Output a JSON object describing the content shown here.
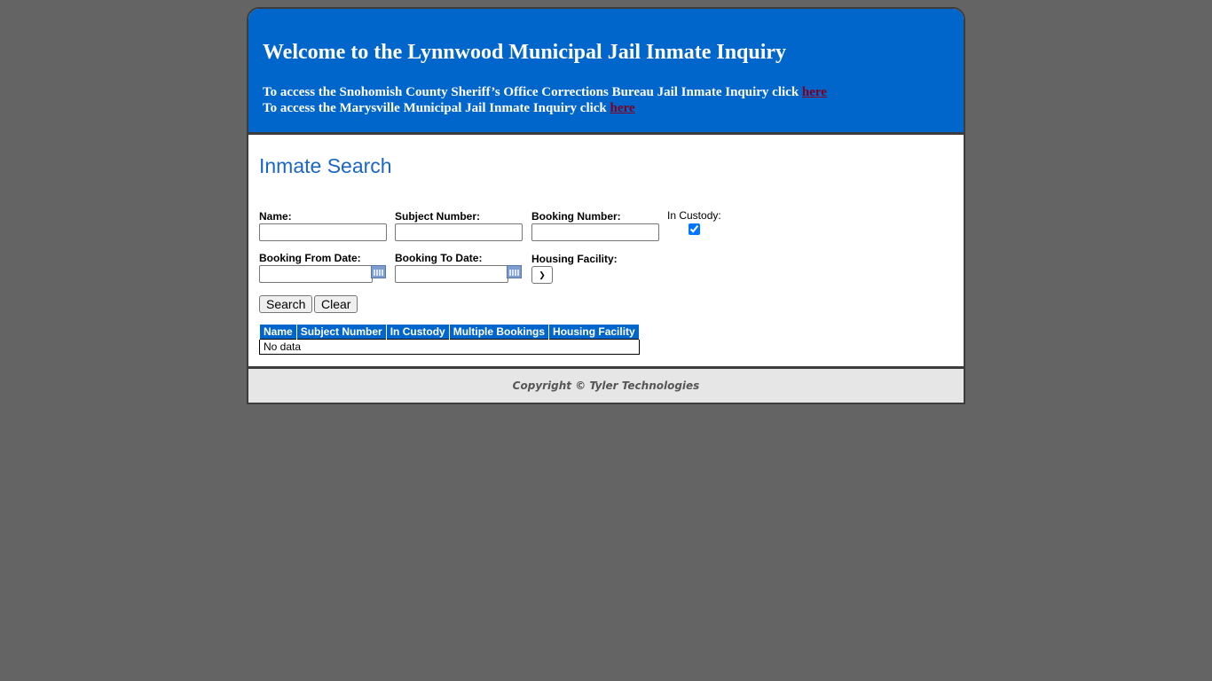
{
  "header": {
    "title": "Welcome to the Lynnwood Municipal Jail Inmate Inquiry",
    "line1_text": "To access the Snohomish County Sheriff’s Office Corrections Bureau Jail Inmate Inquiry click ",
    "line1_link": "here",
    "line2_text": "To access the Marysville Municipal Jail Inmate Inquiry click ",
    "line2_link": "here"
  },
  "search": {
    "title": "Inmate Search",
    "name_label": "Name:",
    "name_value": "",
    "subject_label": "Subject Number:",
    "subject_value": "",
    "booking_label": "Booking Number:",
    "booking_value": "",
    "custody_label": "In Custody:",
    "custody_checked": true,
    "from_label": "Booking From Date:",
    "from_value": "",
    "to_label": "Booking To Date:",
    "to_value": "",
    "housing_label": "Housing Facility:",
    "housing_value": "",
    "search_button": "Search",
    "clear_button": "Clear"
  },
  "results": {
    "columns": [
      "Name",
      "Subject Number",
      "In Custody",
      "Multiple Bookings",
      "Housing Facility"
    ],
    "empty_text": "No data"
  },
  "footer": {
    "copyright": "Copyright © Tyler Technologies"
  }
}
